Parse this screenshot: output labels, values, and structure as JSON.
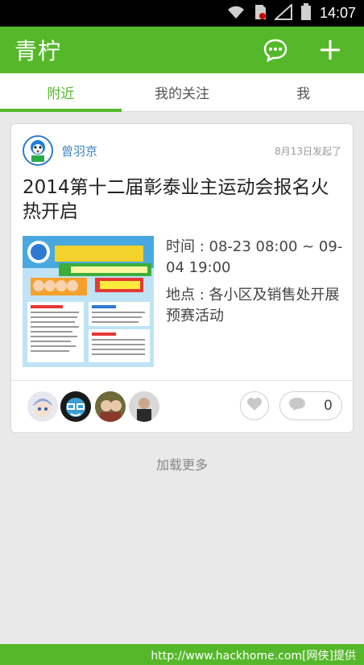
{
  "status_bar": {
    "time": "14:07",
    "icons": [
      "wifi-icon",
      "sim-icon",
      "signal-icon",
      "battery-icon"
    ]
  },
  "app_bar": {
    "logo": "青柠",
    "icons": [
      "chat-bubble-icon",
      "plus-icon"
    ]
  },
  "tabs": [
    {
      "label": "附近",
      "active": true
    },
    {
      "label": "我的关注",
      "active": false
    },
    {
      "label": "我",
      "active": false
    }
  ],
  "post": {
    "author": "曾羽京",
    "posted": "8月13日发起了",
    "title": "2014第十二届彰泰业主运动会报名火热开启",
    "time_label": "时间 : 08-23 08:00 ~ 09-04 19:00",
    "location_label": "地点 : 各小区及销售处开展预赛活动",
    "comment_count": "0"
  },
  "load_more": "加载更多",
  "watermark": "http://www.hackhome.com[网侠]提供",
  "colors": {
    "brand": "#55b82a",
    "link": "#3d84c0"
  }
}
